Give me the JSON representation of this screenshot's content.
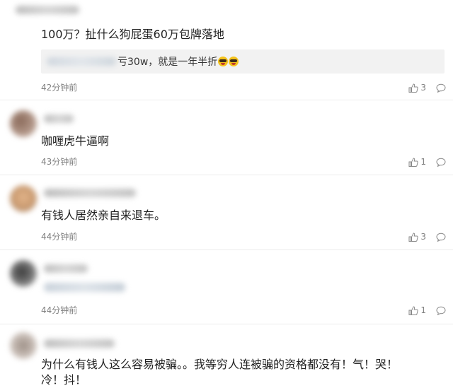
{
  "comments": [
    {
      "content": "100万？扯什么狗屁蛋60万包牌落地",
      "quote": {
        "text": "亏30w，就是一年半折"
      },
      "time": "42分钟前",
      "likes": "3"
    },
    {
      "content": "咖喱虎牛逼啊",
      "time": "43分钟前",
      "likes": "1"
    },
    {
      "content": "有钱人居然亲自来退车。",
      "time": "44分钟前",
      "likes": "3"
    },
    {
      "content": "",
      "time": "44分钟前",
      "likes": "1"
    },
    {
      "content_line1": "为什么有钱人这么容易被骗。。我等穷人连被骗的资格都没有！气！哭！",
      "content_line2": "冷！抖！"
    }
  ],
  "icons": {
    "like": "thumbs-up-icon",
    "reply": "comment-bubble-icon"
  },
  "colors": {
    "time": "#808080",
    "quote_bg": "#f2f2f2",
    "text": "#222222"
  }
}
